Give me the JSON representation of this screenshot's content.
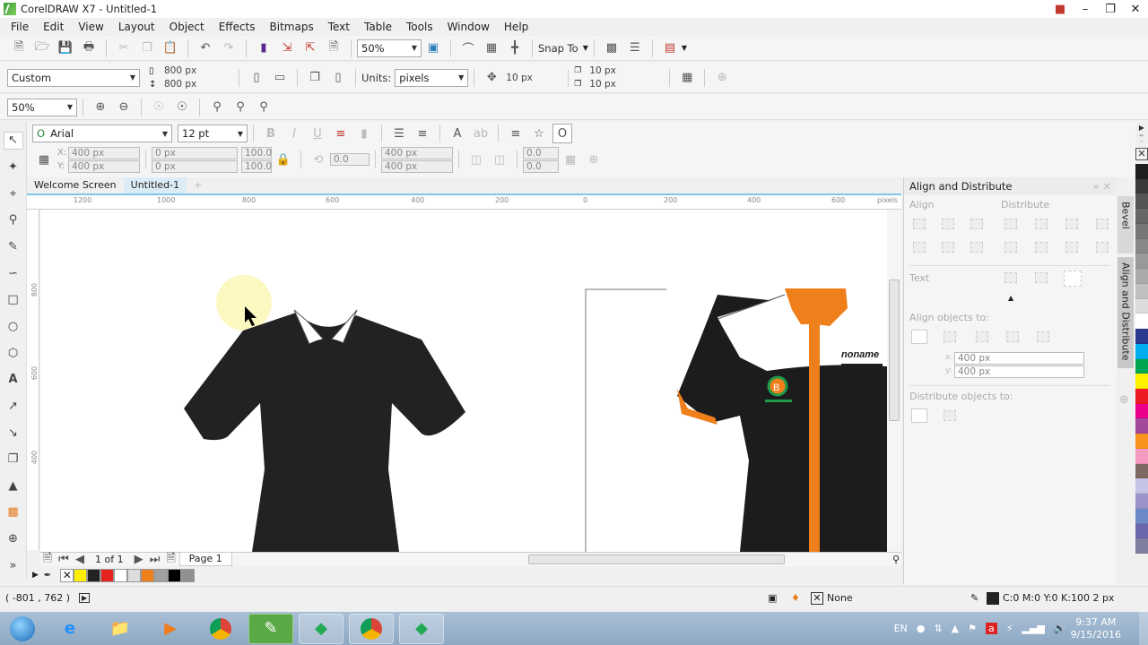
{
  "window": {
    "title": "CorelDRAW X7 - Untitled-1",
    "controls": [
      "user-icon",
      "minimize-icon",
      "restore-icon",
      "close-icon"
    ]
  },
  "menu": [
    "File",
    "Edit",
    "View",
    "Layout",
    "Object",
    "Effects",
    "Bitmaps",
    "Text",
    "Table",
    "Tools",
    "Window",
    "Help"
  ],
  "standard_toolbar": {
    "zoom_level": "50%",
    "snap_to_label": "Snap To"
  },
  "property_bar": {
    "page_preset": "Custom",
    "page_width": "800 px",
    "page_height": "800 px",
    "units_label": "Units:",
    "units_value": "pixels",
    "nudge": "10 px",
    "dup_x": "10 px",
    "dup_y": "10 px"
  },
  "zoom_toolbar": {
    "zoom_level": "50%"
  },
  "text_toolbar": {
    "font_name": "Arial",
    "font_size": "12 pt",
    "x": "400 px",
    "y": "400 px",
    "x_label": "X:",
    "y_label": "Y:",
    "width": "0 px",
    "height": "0 px",
    "scale_x": "100.0",
    "scale_y": "100.0",
    "pct": "%",
    "rotation": "0.0",
    "pos_x2": "400 px",
    "pos_y2": "400 px",
    "skew_a": "0.0",
    "skew_b": "0.0"
  },
  "doc_tabs": [
    {
      "label": "Welcome Screen",
      "active": false
    },
    {
      "label": "Untitled-1",
      "active": true
    }
  ],
  "ruler": {
    "h_ticks": [
      "1200",
      "1000",
      "800",
      "600",
      "400",
      "200",
      "0",
      "200",
      "400",
      "600"
    ],
    "h_unit": "pixels",
    "v_ticks": [
      "800",
      "600",
      "400"
    ],
    "v_unit": "pixels"
  },
  "canvas": {
    "shirts": [
      {
        "name": "plain-black-shirt",
        "body_color": "#222222",
        "collar_color": "#ffffff"
      },
      {
        "name": "designed-shirt",
        "body_color": "#1c1c1c",
        "yoke_color": "#ffffff",
        "accent_color": "#ef7f1a",
        "logo_color": "#1e9a48",
        "name_tag_text": "noname"
      }
    ]
  },
  "page_nav": {
    "counter": "1 of 1",
    "page_tab": "Page 1"
  },
  "document_palette": [
    "none",
    "#ffee00",
    "#222222",
    "#e52420",
    "#ffffff",
    "#dddddd",
    "#ef7f1a",
    "#a0a0a0",
    "#000000",
    "#909090"
  ],
  "docker": {
    "title": "Align and Distribute",
    "align_label": "Align",
    "distribute_label": "Distribute",
    "text_label": "Text",
    "align_objects_to_label": "Align objects to:",
    "x_label": "x:",
    "y_label": "y:",
    "x_value": "400 px",
    "y_value": "400 px",
    "distribute_objects_to_label": "Distribute objects to:",
    "side_tabs": [
      "Bevel",
      "Align and Distribute"
    ]
  },
  "color_palette": [
    "#1e1e1e",
    "#3a3a3a",
    "#555555",
    "#666666",
    "#777777",
    "#888888",
    "#999999",
    "#aaaaaa",
    "#c0c0c0",
    "#dcdcdc",
    "#ffffff",
    "#2b3990",
    "#00aeef",
    "#00a651",
    "#fff200",
    "#ed1c24",
    "#ec008c",
    "#a3489a",
    "#f7941d",
    "#f49ac1",
    "#7d6b63",
    "#c6c4e6",
    "#9b93c9",
    "#6d89c7",
    "#6b67ad",
    "#807e9e"
  ],
  "status": {
    "coords": "( -801 , 762  )",
    "fill_label": "None",
    "outline_label": "C:0 M:0 Y:0 K:100  2 px"
  },
  "taskbar": {
    "apps": [
      "windows-start",
      "internet-explorer",
      "file-explorer",
      "media-player",
      "chrome",
      "coreldraw",
      "corel-app",
      "chrome",
      "corel-app-2"
    ],
    "language": "EN",
    "time": "9:37 AM",
    "date": "9/15/2016"
  }
}
